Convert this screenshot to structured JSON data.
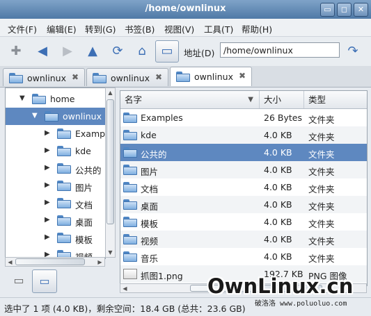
{
  "window": {
    "title": "/home/ownlinux",
    "buttons": [
      "▭",
      "◻",
      "✕"
    ]
  },
  "menu": [
    "文件(F)",
    "编辑(E)",
    "转到(G)",
    "书签(B)",
    "视图(V)",
    "工具(T)",
    "帮助(H)"
  ],
  "toolbar": {
    "address_label": "地址(D)",
    "address_value": "/home/ownlinux"
  },
  "tabs": [
    {
      "label": "ownlinux",
      "close": "✖"
    },
    {
      "label": "ownlinux",
      "close": "✖"
    },
    {
      "label": "ownlinux",
      "close": "✖"
    }
  ],
  "tree": [
    {
      "label": "home",
      "arrow": "▼"
    },
    {
      "label": "ownlinux",
      "arrow": "▼"
    },
    {
      "label": "Examples",
      "arrow": "▶"
    },
    {
      "label": "kde",
      "arrow": "▶"
    },
    {
      "label": "公共的",
      "arrow": "▶"
    },
    {
      "label": "图片",
      "arrow": "▶"
    },
    {
      "label": "文档",
      "arrow": "▶"
    },
    {
      "label": "桌面",
      "arrow": "▶"
    },
    {
      "label": "模板",
      "arrow": "▶"
    },
    {
      "label": "视频",
      "arrow": "▶"
    }
  ],
  "columns": [
    "名字",
    "大小",
    "类型"
  ],
  "files": [
    {
      "name": "Examples",
      "size": "26 Bytes",
      "type": "文件夹"
    },
    {
      "name": "kde",
      "size": "4.0 KB",
      "type": "文件夹"
    },
    {
      "name": "公共的",
      "size": "4.0 KB",
      "type": "文件夹"
    },
    {
      "name": "图片",
      "size": "4.0 KB",
      "type": "文件夹"
    },
    {
      "name": "文档",
      "size": "4.0 KB",
      "type": "文件夹"
    },
    {
      "name": "桌面",
      "size": "4.0 KB",
      "type": "文件夹"
    },
    {
      "name": "模板",
      "size": "4.0 KB",
      "type": "文件夹"
    },
    {
      "name": "视频",
      "size": "4.0 KB",
      "type": "文件夹"
    },
    {
      "name": "音乐",
      "size": "4.0 KB",
      "type": "文件夹"
    },
    {
      "name": "抓图1.png",
      "size": "192.7 KB",
      "type": "PNG 图像"
    }
  ],
  "status": "选中了 1 项 (4.0 KB)，剩余空间：18.4 GB (总共：23.6 GB)",
  "watermark": {
    "main": "OwnLinux.cn",
    "sub": "破洛洛 www.poluoluo.com"
  }
}
